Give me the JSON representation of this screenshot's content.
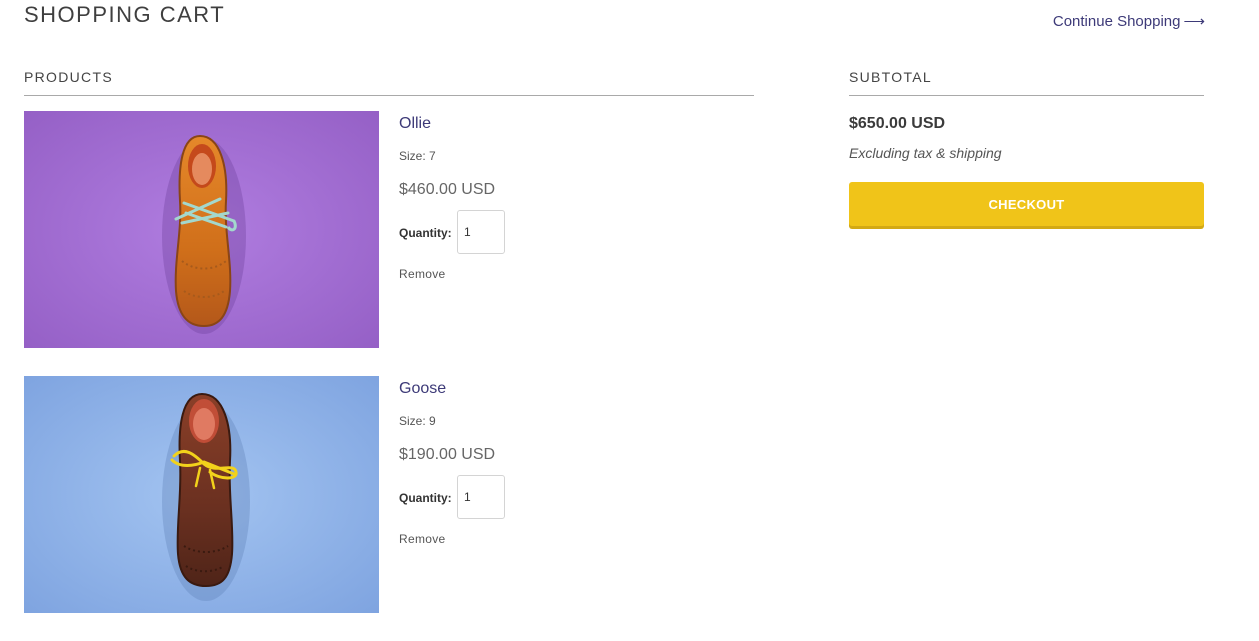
{
  "header": {
    "title": "SHOPPING CART",
    "continue_label": "Continue Shopping",
    "continue_arrow": "⟶"
  },
  "products_section": {
    "heading": "PRODUCTS"
  },
  "subtotal_section": {
    "heading": "SUBTOTAL",
    "amount": "$650.00 USD",
    "note": "Excluding tax & shipping",
    "checkout_label": "CHECKOUT"
  },
  "items": [
    {
      "name": "Ollie",
      "size": "Size: 7",
      "price": "$460.00 USD",
      "quantity_label": "Quantity:",
      "quantity": "1",
      "remove_label": "Remove",
      "image_bg": "#a46fd3",
      "shoe_color": "#d9771e",
      "lace_color": "#9fd3c9"
    },
    {
      "name": "Goose",
      "size": "Size: 9",
      "price": "$190.00 USD",
      "quantity_label": "Quantity:",
      "quantity": "1",
      "remove_label": "Remove",
      "image_bg": "#8fb3ea",
      "shoe_color": "#6b3322",
      "lace_color": "#f2d21b"
    }
  ],
  "colors": {
    "accent_link": "#3d3a78",
    "checkout_button": "#f0c419"
  }
}
